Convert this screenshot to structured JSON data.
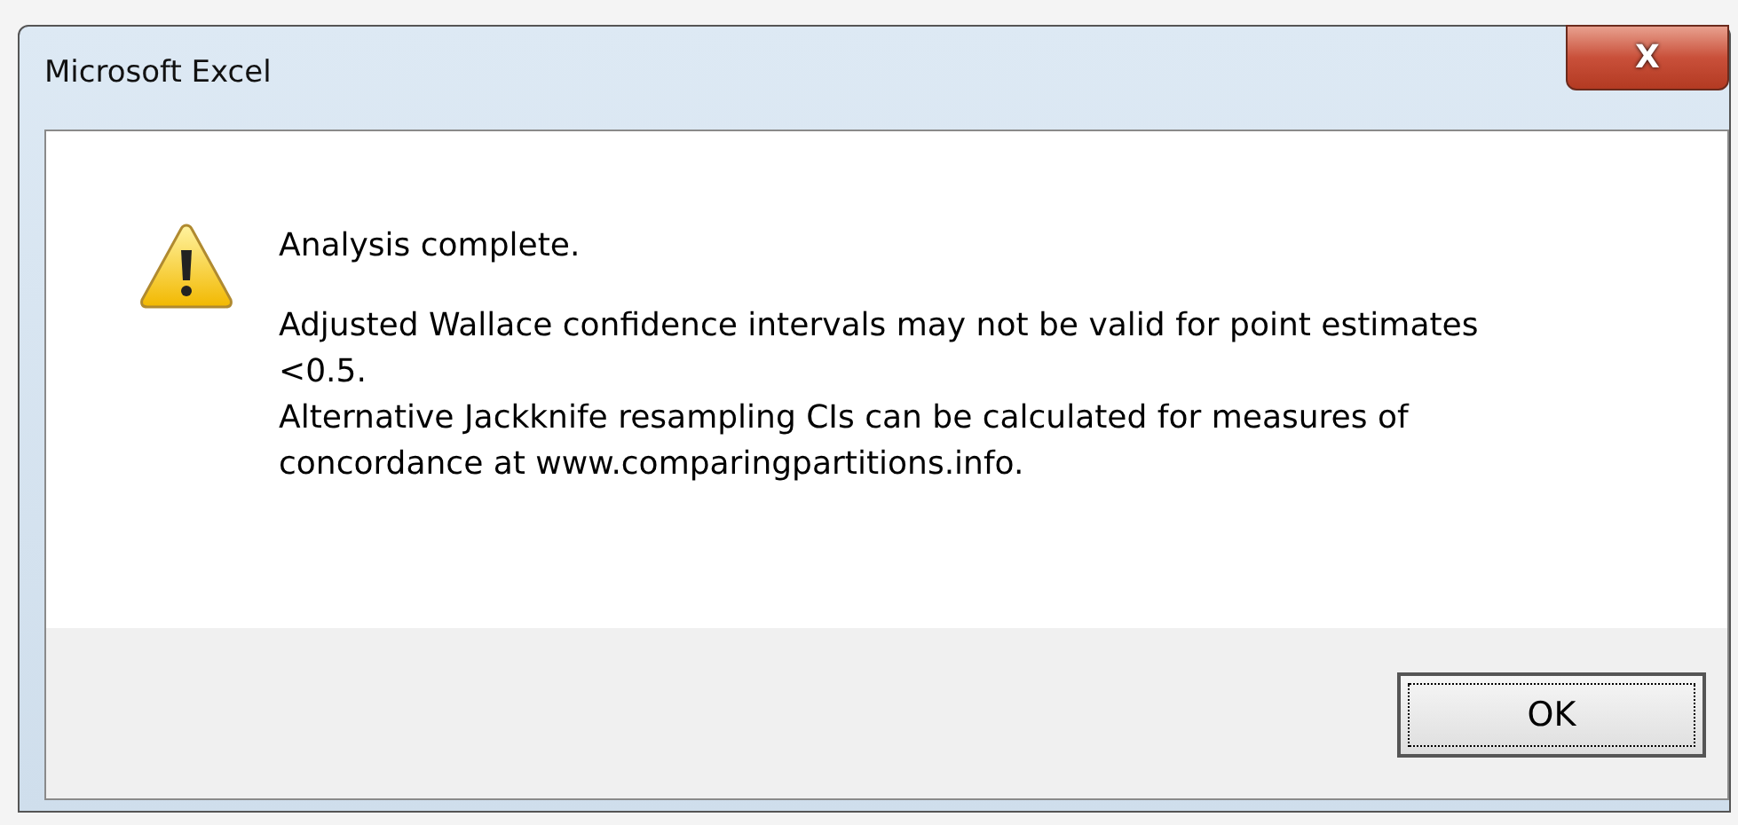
{
  "window": {
    "title": "Microsoft Excel",
    "close_label": "X"
  },
  "message": {
    "heading": "Analysis complete.",
    "paragraphs": [
      "Adjusted Wallace confidence intervals may not be valid for point estimates <0.5.",
      "Alternative Jackknife resampling CIs can be calculated for measures of concordance at www.comparingpartitions.info."
    ]
  },
  "buttons": [
    {
      "label": "OK",
      "focused": true
    }
  ]
}
